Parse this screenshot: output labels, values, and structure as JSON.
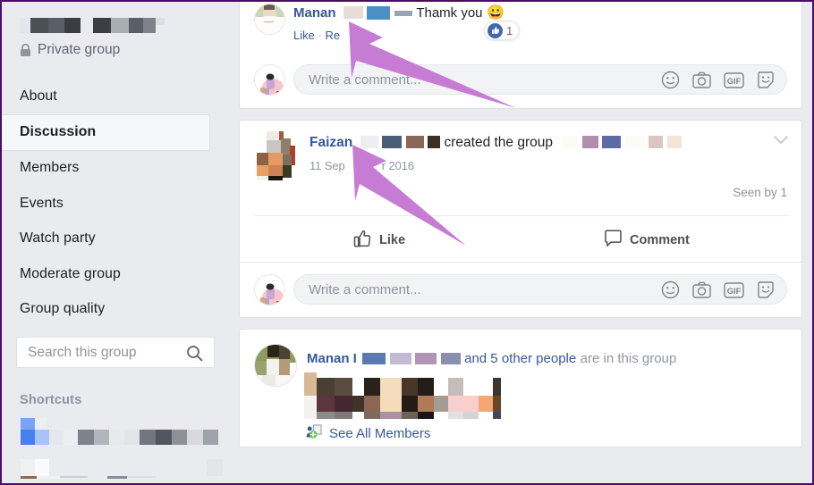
{
  "window": {
    "border_color": "#4b0b6b",
    "background": "#e9ebee"
  },
  "sidebar": {
    "group_name_redacted": true,
    "privacy": {
      "label": "Private group",
      "icon": "lock-icon"
    },
    "nav": [
      {
        "label": "About",
        "active": false
      },
      {
        "label": "Discussion",
        "active": true
      },
      {
        "label": "Members",
        "active": false
      },
      {
        "label": "Events",
        "active": false
      },
      {
        "label": "Watch party",
        "active": false
      },
      {
        "label": "Moderate group",
        "active": false
      },
      {
        "label": "Group quality",
        "active": false
      }
    ],
    "search": {
      "placeholder": "Search this group",
      "value": "",
      "icon": "search-icon"
    },
    "shortcuts": {
      "label": "Shortcuts"
    }
  },
  "feed": {
    "post_top": {
      "comment": {
        "author": "Manan",
        "author_redacted": true,
        "text": "Thamk you",
        "emoji": "😀",
        "actions": [
          "Like",
          "Re"
        ],
        "separator": "·",
        "reaction": {
          "icon": "thumbs-up-icon",
          "count": "1"
        }
      },
      "composer": {
        "placeholder": "Write a comment...",
        "icons": [
          "emoji-icon",
          "camera-icon",
          "gif-icon",
          "sticker-icon"
        ]
      }
    },
    "post_created": {
      "author": "Faizan",
      "author_redacted": true,
      "action_text": "created the group",
      "group_name_redacted": true,
      "date": "11 Sep",
      "date_tail": "r 2016",
      "seen_by": "Seen by 1",
      "menu_icon": "chevron-down-icon",
      "buttons": [
        {
          "label": "Like",
          "icon": "thumbs-up-outline-icon"
        },
        {
          "label": "Comment",
          "icon": "comment-bubble-icon"
        }
      ],
      "composer": {
        "placeholder": "Write a comment...",
        "icons": [
          "emoji-icon",
          "camera-icon",
          "gif-icon",
          "sticker-icon"
        ]
      }
    },
    "post_members": {
      "author": "Manan I",
      "author_redacted": true,
      "middle_link": "and 5 other people",
      "trailing_text": "are in this group",
      "see_all": {
        "label": "See All Members",
        "icon": "add-member-icon"
      }
    }
  },
  "annotations": {
    "arrow_color": "#c77cd4",
    "arrows": [
      {
        "name": "arrow-to-comment-author",
        "points_at": "Manan"
      },
      {
        "name": "arrow-to-post-author",
        "points_at": "Faizan"
      }
    ]
  }
}
